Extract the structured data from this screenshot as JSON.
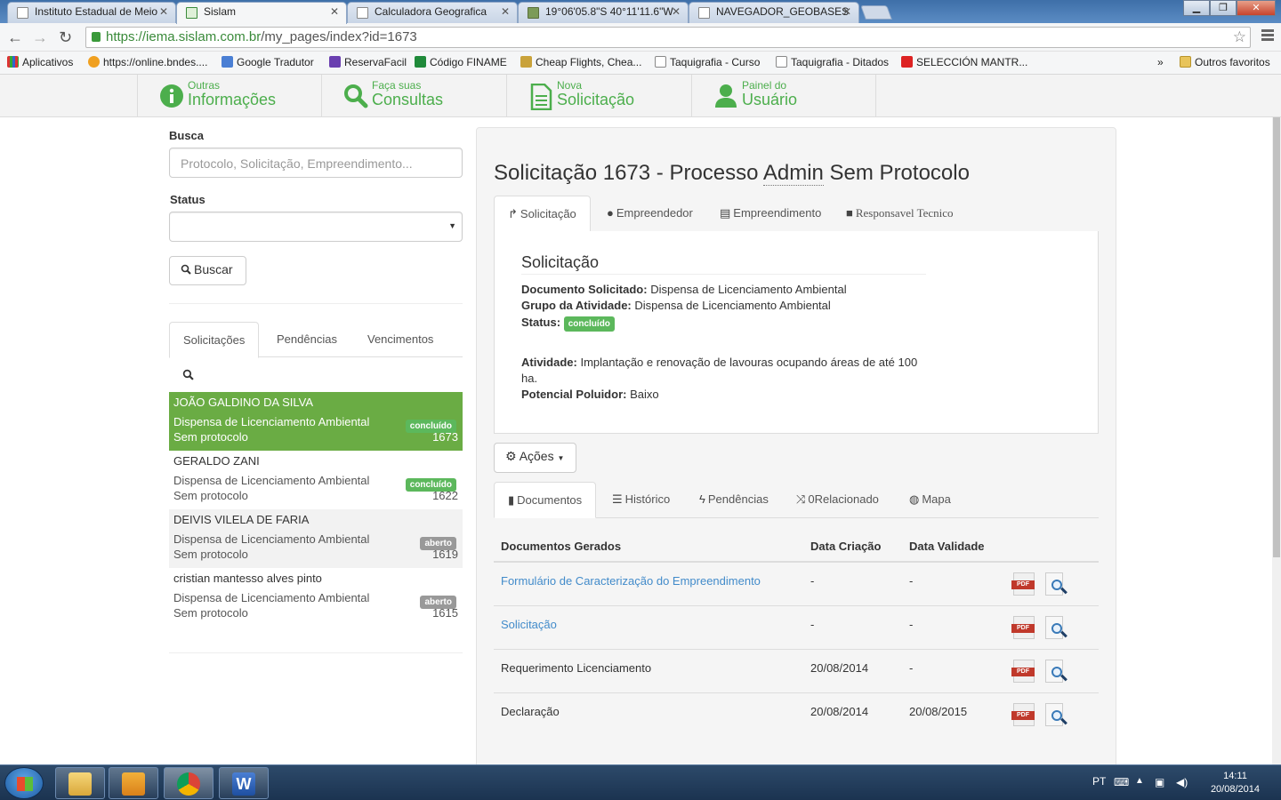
{
  "browser": {
    "tabs": [
      {
        "title": "Instituto Estadual de Meio",
        "active": false
      },
      {
        "title": "Sislam",
        "active": true
      },
      {
        "title": "Calculadora Geografica",
        "active": false
      },
      {
        "title": "19°06'05.8\"S 40°11'11.6\"W",
        "active": false
      },
      {
        "title": "NAVEGADOR_GEOBASES",
        "active": false
      }
    ],
    "url_host": "https://iema.sislam.com.br",
    "url_path": "/my_pages/index?id=1673",
    "bookmarks": [
      "Aplicativos",
      "https://online.bndes....",
      "Google Tradutor",
      "ReservaFacil",
      "Código FINAME",
      "Cheap Flights, Chea...",
      "Taquigrafia - Curso",
      "Taquigrafia - Ditados",
      "SELECCIÓN MANTR...",
      "»",
      "Outros favoritos"
    ]
  },
  "appnav": [
    {
      "small": "Outras",
      "big": "Informações",
      "icon": "info-icon"
    },
    {
      "small": "Faça suas",
      "big": "Consultas",
      "icon": "search-icon"
    },
    {
      "small": "Nova",
      "big": "Solicitação",
      "icon": "document-icon"
    },
    {
      "small": "Painel do",
      "big": "Usuário",
      "icon": "user-icon"
    }
  ],
  "search": {
    "busca_label": "Busca",
    "busca_placeholder": "Protocolo, Solicitação, Empreendimento...",
    "status_label": "Status",
    "status_value": "",
    "buscar_button": "Buscar"
  },
  "list_tabs": [
    "Solicitações",
    "Pendências",
    "Vencimentos"
  ],
  "list": [
    {
      "name": "JOÃO GALDINO DA SILVA",
      "doc": "Dispensa de Licenciamento Ambiental",
      "protocol": "Sem protocolo",
      "status": "concluído",
      "number": "1673"
    },
    {
      "name": "GERALDO ZANI",
      "doc": "Dispensa de Licenciamento Ambiental",
      "protocol": "Sem protocolo",
      "status": "concluído",
      "number": "1622"
    },
    {
      "name": "DEIVIS VILELA DE FARIA",
      "doc": "Dispensa de Licenciamento Ambiental",
      "protocol": "Sem protocolo",
      "status": "aberto",
      "number": "1619"
    },
    {
      "name": "cristian mantesso alves pinto",
      "doc": "Dispensa de Licenciamento Ambiental",
      "protocol": "Sem protocolo",
      "status": "aberto",
      "number": "1615"
    }
  ],
  "detail": {
    "title_prefix": "Solicitação 1673 - Processo ",
    "title_abbr": "Admin",
    "title_suffix": " Sem Protocolo",
    "tabs": [
      "Solicitação",
      "Empreendedor",
      "Empreendimento",
      "Responsavel Tecnico"
    ],
    "section_title": "Solicitação",
    "doc_label": "Documento Solicitado:",
    "doc_value": "Dispensa de Licenciamento Ambiental",
    "grupo_label": "Grupo da Atividade:",
    "grupo_value": "Dispensa de Licenciamento Ambiental",
    "status_label": "Status:",
    "status_value": "concluído",
    "atividade_label": "Atividade:",
    "atividade_value": "Implantação e renovação de lavouras ocupando áreas de até 100 ha.",
    "potencial_label": "Potencial Poluidor:",
    "potencial_value": "Baixo",
    "acoes_button": "Ações",
    "bottom_tabs": [
      "Documentos",
      "Histórico",
      "Pendências",
      "0Relacionado",
      "Mapa"
    ],
    "table_headers": [
      "Documentos Gerados",
      "Data Criação",
      "Data Validade"
    ],
    "table_rows": [
      {
        "name": "Formulário de Caracterização do Empreendimento",
        "link": true,
        "created": "-",
        "valid": "-"
      },
      {
        "name": "Solicitação",
        "link": true,
        "created": "-",
        "valid": "-"
      },
      {
        "name": "Requerimento Licenciamento",
        "link": false,
        "created": "20/08/2014",
        "valid": "-"
      },
      {
        "name": "Declaração",
        "link": false,
        "created": "20/08/2014",
        "valid": "20/08/2015"
      }
    ],
    "pdf_label": "PDF"
  },
  "taskbar": {
    "lang": "PT",
    "time": "14:11",
    "date": "20/08/2014"
  }
}
